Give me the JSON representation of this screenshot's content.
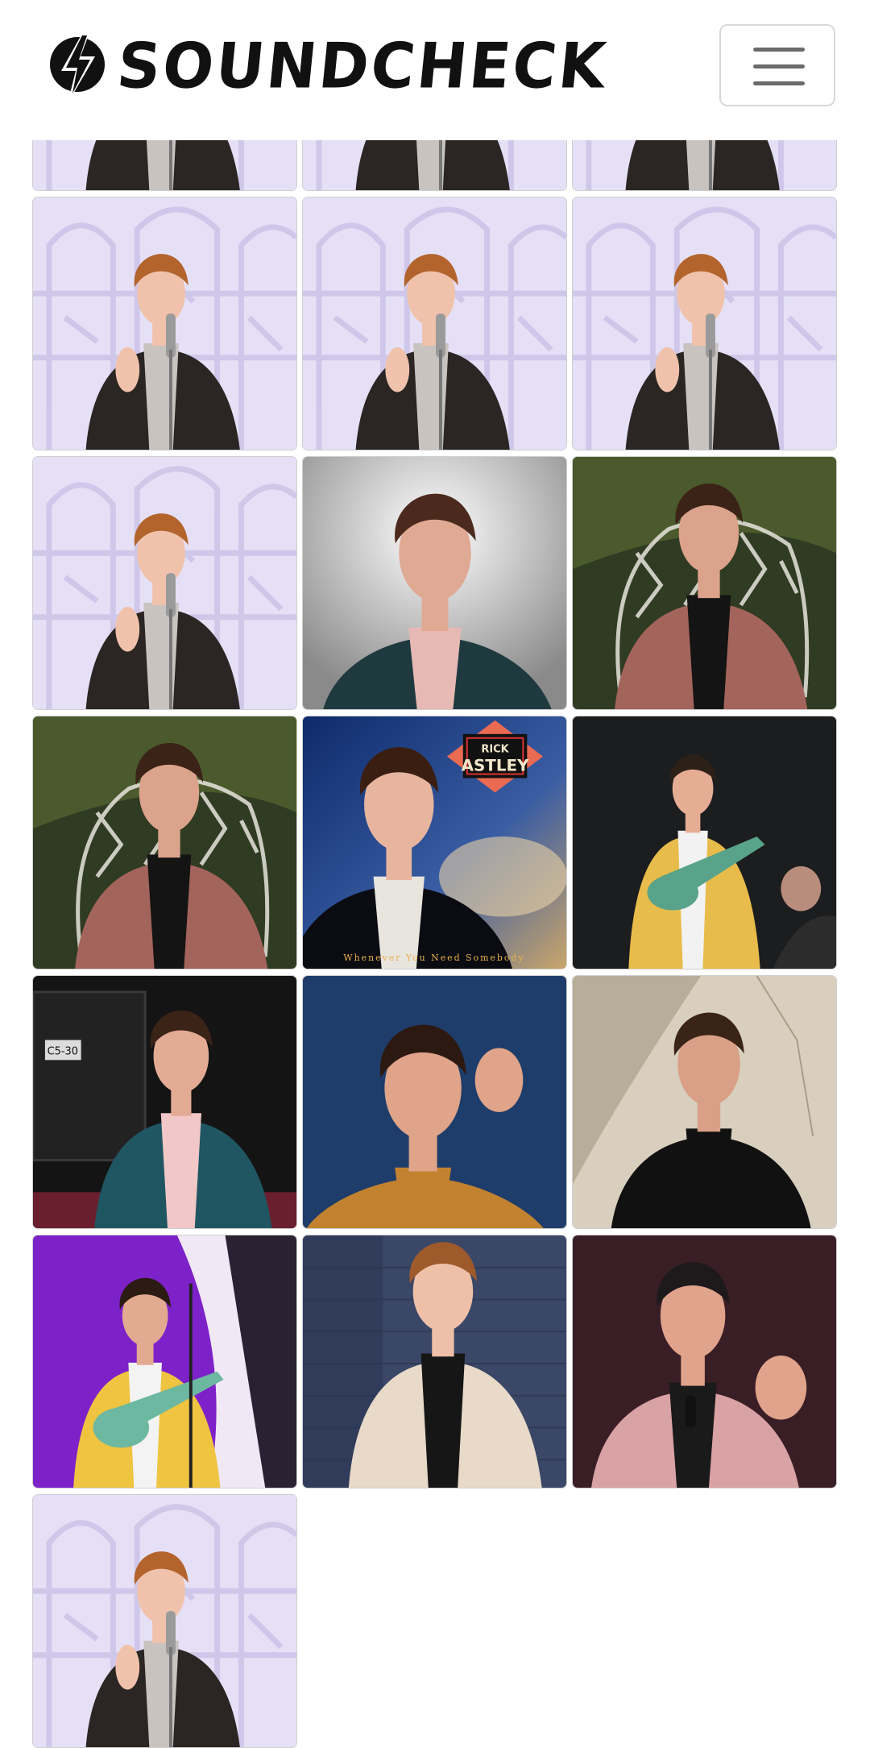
{
  "header": {
    "brand_name": "SOUNDCHECK",
    "brand_icon": "lightning-bolt-icon",
    "menu_icon": "hamburger-menu-icon"
  },
  "gallery": {
    "photos": [
      {
        "scene": "stained-window"
      },
      {
        "scene": "stained-window"
      },
      {
        "scene": "stained-window"
      },
      {
        "scene": "stained-window"
      },
      {
        "scene": "stained-window"
      },
      {
        "scene": "stained-window"
      },
      {
        "scene": "stained-window"
      },
      {
        "scene": "studio-grey"
      },
      {
        "scene": "garden-chair"
      },
      {
        "scene": "garden-chair"
      },
      {
        "scene": "album-cover",
        "cover_title_line1": "RICK",
        "cover_title_line2": "ASTLEY",
        "cover_caption": "Whenever You Need Somebody"
      },
      {
        "scene": "stage-dark"
      },
      {
        "scene": "backstage",
        "case_label": "C5-30"
      },
      {
        "scene": "blue-studio"
      },
      {
        "scene": "stone-wall"
      },
      {
        "scene": "purple-stage"
      },
      {
        "scene": "brick-wall"
      },
      {
        "scene": "singing-dark"
      },
      {
        "scene": "stained-window"
      }
    ]
  },
  "colors": {
    "brand": "#111111",
    "toggler_border": "#d8d8d8",
    "toggler_bars": "#6b6b6b"
  }
}
